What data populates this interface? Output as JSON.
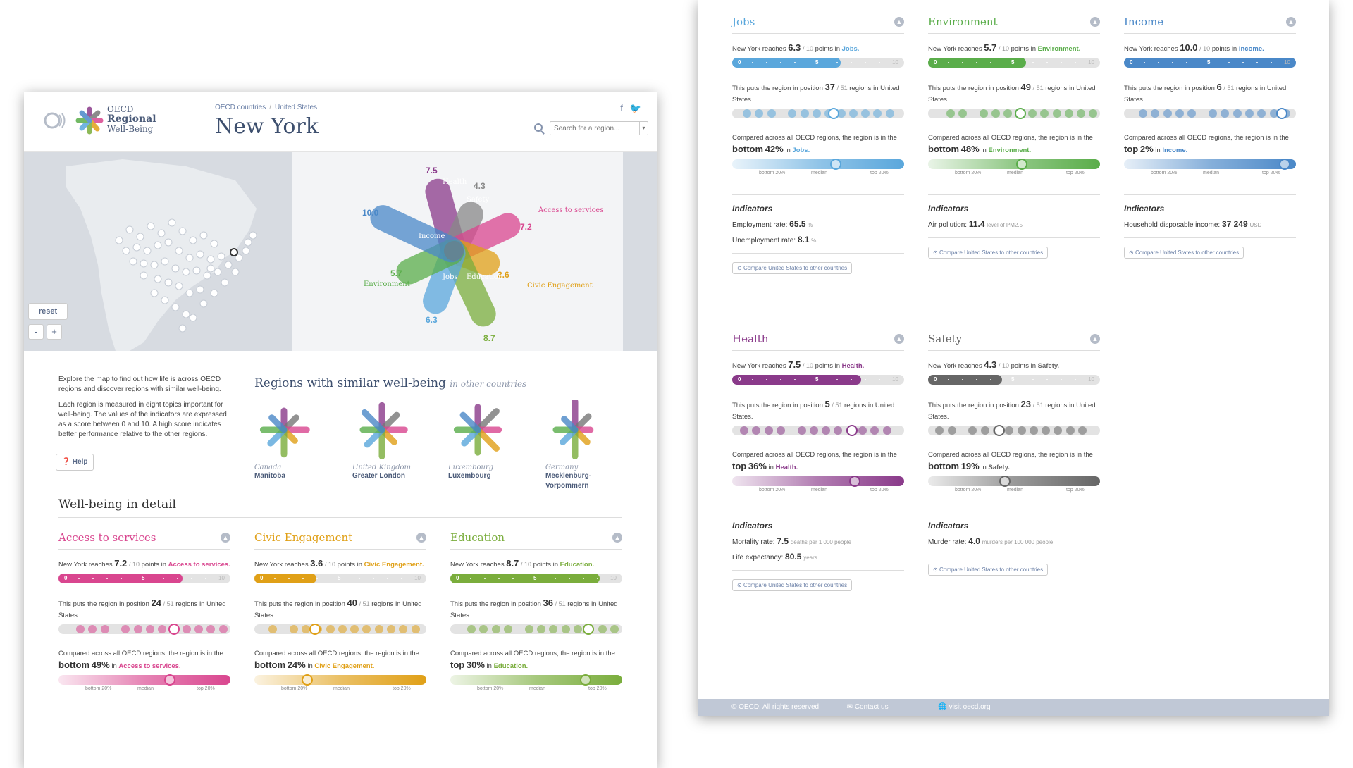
{
  "logo": {
    "line1": "OECD",
    "line2": "Regional",
    "line3": "Well-Being"
  },
  "breadcrumb": {
    "item1": "OECD countries",
    "item2": "United States"
  },
  "page_title": "New York",
  "search": {
    "placeholder": "Search for a region..."
  },
  "map": {
    "reset_label": "reset",
    "zoom_out_label": "-",
    "zoom_in_label": "+",
    "flower_labels": {
      "health": "Health",
      "safety": "Safety",
      "income": "Income",
      "access": "Access to services",
      "environment": "Environment",
      "jobs": "Jobs",
      "education": "Education",
      "civic": "Civic Engagement"
    },
    "flower_values": {
      "health": "7.5",
      "safety": "4.3",
      "income": "10.0",
      "access": "7.2",
      "environment": "5.7",
      "jobs": "6.3",
      "education": "8.7",
      "civic": "3.6"
    }
  },
  "intro": {
    "p1": "Explore the map to find out how life is across OECD regions and discover regions with similar well-being.",
    "p2": "Each region is measured in eight topics important for well-being. The values of the indicators are expressed as a score between 0 and 10. A high score indicates better performance relative to the other regions.",
    "help_label": "Help"
  },
  "similar": {
    "title": "Regions with similar well-being",
    "subtitle": "in other countries",
    "items": [
      {
        "country": "Canada",
        "region": "Manitoba"
      },
      {
        "country": "United Kingdom",
        "region": "Greater London"
      },
      {
        "country": "Luxembourg",
        "region": "Luxembourg"
      },
      {
        "country": "Germany",
        "region": "Mecklenburg-Vorpommern"
      }
    ]
  },
  "detail_title": "Well-being in detail",
  "common": {
    "reaches_prefix": "New York reaches",
    "of_ten": "/ 10",
    "points_in": "points in",
    "position_prefix": "This puts the region in position",
    "of_regions": "/ 51",
    "regions_in": "regions in",
    "country": "United States.",
    "compared_text": "Compared across all OECD regions, the region is in the",
    "in_word": "in",
    "indicators_title": "Indicators",
    "compare_link": "Compare United States to other countries",
    "bottom20": "bottom 20%",
    "median": "median",
    "top20": "top 20%",
    "t0": "0",
    "t5": "5",
    "t10": "10"
  },
  "topics": [
    {
      "key": "access",
      "title": "Access to services",
      "color": "#d9468f",
      "score": "7.2",
      "topic_label": "Access to services.",
      "position": "24",
      "rank_word": "bottom",
      "rank_pct": "49%",
      "fill": 0.72,
      "cmp": 0.67,
      "indicators": []
    },
    {
      "key": "civic",
      "title": "Civic Engagement",
      "color": "#e0a017",
      "score": "3.6",
      "topic_label": "Civic Engagement.",
      "position": "40",
      "rank_word": "bottom",
      "rank_pct": "24%",
      "fill": 0.36,
      "cmp": 0.3,
      "indicators": []
    },
    {
      "key": "education",
      "title": "Education",
      "color": "#7aad3c",
      "score": "8.7",
      "topic_label": "Education.",
      "position": "36",
      "rank_word": "top",
      "rank_pct": "30%",
      "fill": 0.87,
      "cmp": 0.82,
      "indicators": []
    },
    {
      "key": "jobs",
      "title": "Jobs",
      "color": "#5aa7dc",
      "score": "6.3",
      "topic_label": "Jobs.",
      "position": "37",
      "rank_word": "bottom",
      "rank_pct": "42%",
      "fill": 0.63,
      "cmp": 0.62,
      "indicators": [
        {
          "label": "Employment rate:",
          "value": "65.5",
          "unit": "%"
        },
        {
          "label": "Unemployment rate:",
          "value": "8.1",
          "unit": "%"
        }
      ]
    },
    {
      "key": "environment",
      "title": "Environment",
      "color": "#5aad4a",
      "score": "5.7",
      "topic_label": "Environment.",
      "position": "49",
      "rank_word": "bottom",
      "rank_pct": "48%",
      "fill": 0.57,
      "cmp": 0.56,
      "indicators": [
        {
          "label": "Air pollution:",
          "value": "11.4",
          "unit": "level of PM2.5"
        }
      ]
    },
    {
      "key": "income",
      "title": "Income",
      "color": "#4a88c8",
      "score": "10.0",
      "topic_label": "Income.",
      "position": "6",
      "rank_word": "top",
      "rank_pct": "2%",
      "fill": 1.0,
      "cmp": 0.98,
      "indicators": [
        {
          "label": "Household disposable income:",
          "value": "37 249",
          "unit": "USD"
        }
      ]
    },
    {
      "key": "health",
      "title": "Health",
      "color": "#8a3a8a",
      "score": "7.5",
      "topic_label": "Health.",
      "position": "5",
      "rank_word": "top",
      "rank_pct": "36%",
      "fill": 0.75,
      "cmp": 0.74,
      "indicators": [
        {
          "label": "Mortality rate:",
          "value": "7.5",
          "unit": "deaths per 1 000 people"
        },
        {
          "label": "Life expectancy:",
          "value": "80.5",
          "unit": "years"
        }
      ]
    },
    {
      "key": "safety",
      "title": "Safety",
      "color": "#666666",
      "score": "4.3",
      "topic_label": "Safety.",
      "position": "23",
      "rank_word": "bottom",
      "rank_pct": "19%",
      "fill": 0.43,
      "cmp": 0.45,
      "indicators": [
        {
          "label": "Murder rate:",
          "value": "4.0",
          "unit": "murders per 100 000 people"
        }
      ]
    }
  ],
  "footer": {
    "copyright": "© OECD. All rights reserved.",
    "contact": "Contact us",
    "visit": "visit oecd.org"
  }
}
